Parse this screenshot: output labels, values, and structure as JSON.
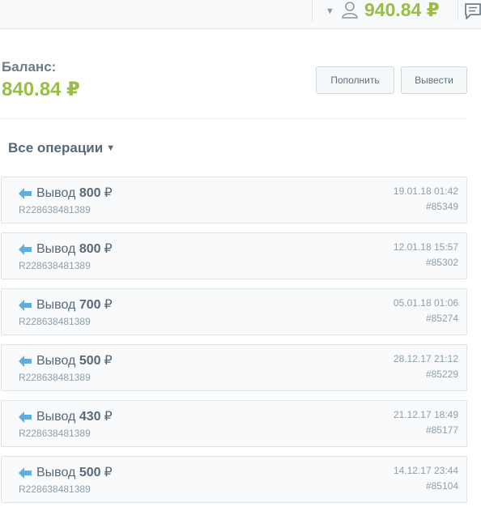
{
  "header": {
    "balance": "940.84 ₽",
    "icons": [
      "chevron-down-icon",
      "user-icon",
      "chat-icon"
    ]
  },
  "balance": {
    "label": "Баланс:",
    "amount": "840.84 ₽",
    "topup_label": "Пополнить",
    "withdraw_label": "Вывести"
  },
  "filter": {
    "label": "Все операции"
  },
  "operations": [
    {
      "type": "Вывод",
      "amount": "800",
      "currency": "₽",
      "account": "R228638481389",
      "date": "19.01.18 01:42",
      "id": "#85349"
    },
    {
      "type": "Вывод",
      "amount": "800",
      "currency": "₽",
      "account": "R228638481389",
      "date": "12.01.18 15:57",
      "id": "#85302"
    },
    {
      "type": "Вывод",
      "amount": "700",
      "currency": "₽",
      "account": "R228638481389",
      "date": "05.01.18 01:06",
      "id": "#85274"
    },
    {
      "type": "Вывод",
      "amount": "500",
      "currency": "₽",
      "account": "R228638481389",
      "date": "28.12.17 21:12",
      "id": "#85229"
    },
    {
      "type": "Вывод",
      "amount": "430",
      "currency": "₽",
      "account": "R228638481389",
      "date": "21.12.17 18:49",
      "id": "#85177"
    },
    {
      "type": "Вывод",
      "amount": "500",
      "currency": "₽",
      "account": "R228638481389",
      "date": "14.12.17 23:44",
      "id": "#85104"
    }
  ],
  "colors": {
    "accent_green": "#9bbd47",
    "arrow_blue": "#5aaee0",
    "text": "#56697a"
  }
}
